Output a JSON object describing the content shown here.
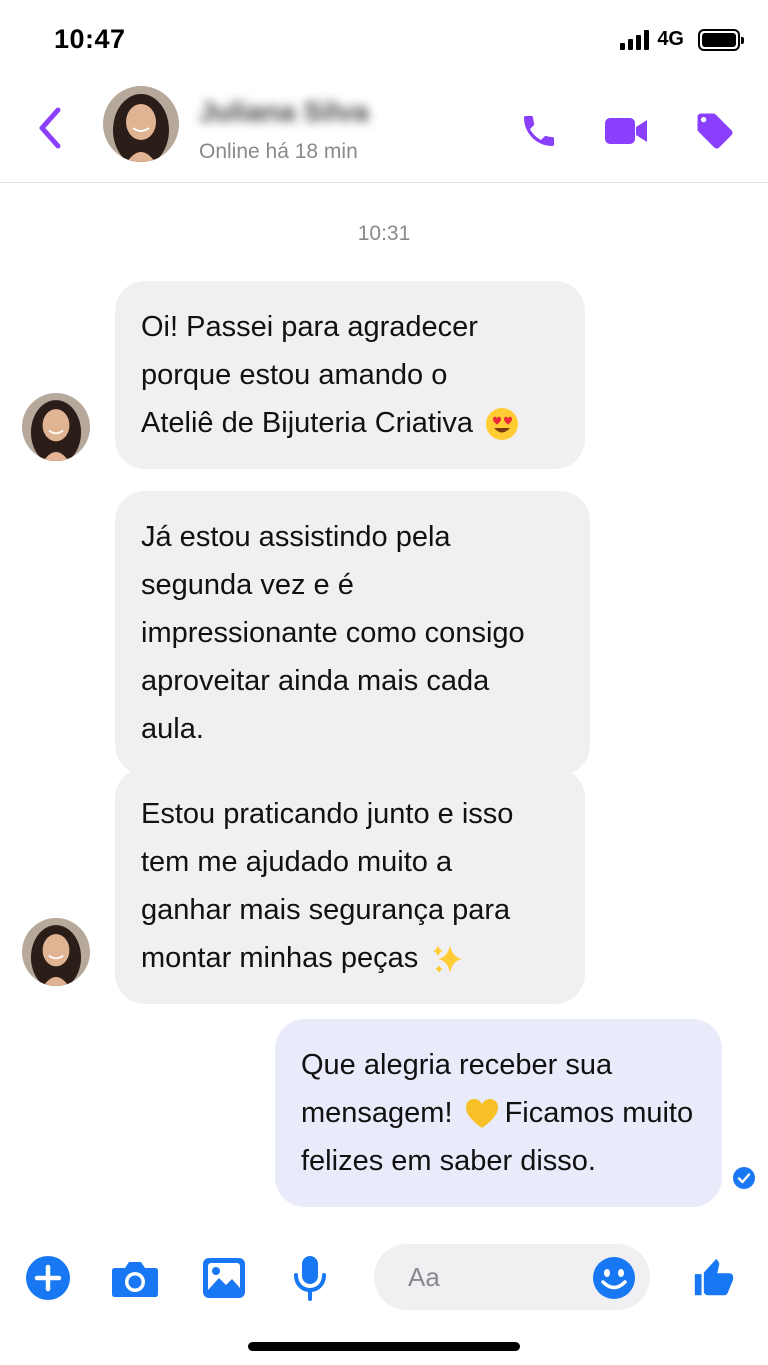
{
  "status_bar": {
    "time": "10:47",
    "network": "4G",
    "signal_icon": "cellular-signal-icon",
    "battery_icon": "battery-icon"
  },
  "header": {
    "contact_name": "Juliana Silva",
    "presence": "Online há 18 min",
    "back_icon": "chevron-left-icon",
    "actions": [
      "phone-icon",
      "video-camera-icon",
      "tag-icon"
    ],
    "accent_color": "#8a3ffc"
  },
  "conversation": {
    "timestamp": "10:31",
    "messages": [
      {
        "direction": "incoming",
        "lines": [
          "Oi! Passei para agradecer",
          "porque estou amando o",
          "Ateliê de Bijuteria Criativa"
        ],
        "emoji": "heart-eyes-emoji"
      },
      {
        "direction": "incoming",
        "lines": [
          "Já estou assistindo pela",
          "segunda vez e é",
          "impressionante como consigo",
          "aproveitar ainda mais cada",
          "aula."
        ]
      },
      {
        "direction": "incoming",
        "lines": [
          "Estou praticando junto e isso",
          "tem me ajudado muito a",
          "ganhar mais segurança para",
          "montar minhas peças"
        ],
        "emoji": "sparkles-emoji"
      },
      {
        "direction": "outgoing",
        "lines": [
          "Que alegria receber sua",
          "mensagem!",
          "Ficamos muito",
          "felizes em saber disso."
        ],
        "emoji": "yellow-heart-emoji",
        "status": "read-check-icon"
      }
    ],
    "incoming_bubble_color": "#f0f0f2",
    "outgoing_bubble_color": "#e9ebfb"
  },
  "composer": {
    "placeholder": "Aa",
    "icons": [
      "plus-circle-icon",
      "camera-icon",
      "gallery-icon",
      "microphone-icon",
      "emoji-icon",
      "thumbs-up-icon"
    ],
    "icon_color": "#1877f2"
  }
}
